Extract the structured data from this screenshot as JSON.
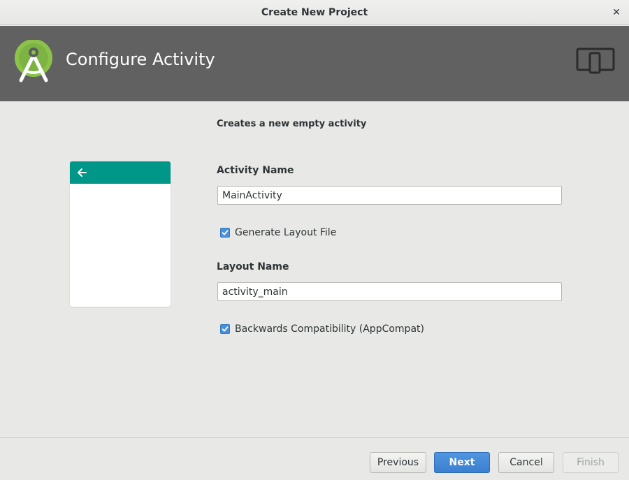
{
  "window": {
    "title": "Create New Project",
    "close_glyph": "✕"
  },
  "header": {
    "title": "Configure Activity",
    "logo_icon": "android-studio-logo-icon",
    "device_icon": "phone-tablet-icon"
  },
  "form": {
    "subtitle": "Creates a new empty activity",
    "activity_name_label": "Activity Name",
    "activity_name_value": "MainActivity",
    "generate_layout_label": "Generate Layout File",
    "generate_layout_checked": true,
    "layout_name_label": "Layout Name",
    "layout_name_value": "activity_main",
    "backwards_compat_label": "Backwards Compatibility (AppCompat)",
    "backwards_compat_checked": true
  },
  "preview": {
    "appbar_color": "#009688",
    "back_icon": "arrow-left-icon"
  },
  "buttons": {
    "previous": "Previous",
    "next": "Next",
    "cancel": "Cancel",
    "finish": "Finish"
  },
  "colors": {
    "header_bg": "#616161",
    "accent_blue": "#4a90d9",
    "android_green": "#8bc34a"
  }
}
